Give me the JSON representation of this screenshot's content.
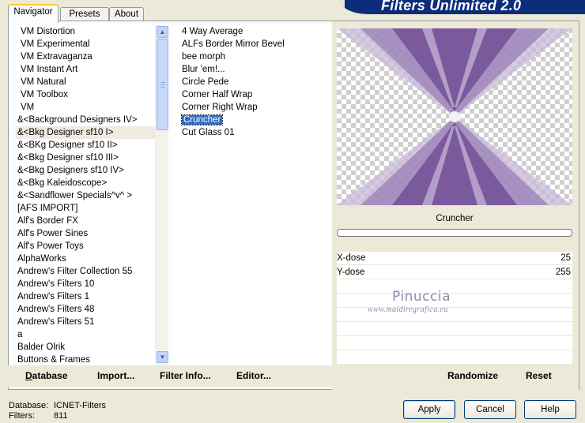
{
  "header": {
    "title": "Filters Unlimited 2.0"
  },
  "tabs": [
    {
      "label": "Navigator",
      "active": true
    },
    {
      "label": "Presets",
      "active": false
    },
    {
      "label": "About",
      "active": false
    }
  ],
  "categories": [
    "VM Distortion",
    "VM Experimental",
    "VM Extravaganza",
    "VM Instant Art",
    "VM Natural",
    "VM Toolbox",
    "VM",
    "&<Background Designers IV>",
    "&<Bkg Designer sf10 I>",
    "&<BKg Designer sf10 II>",
    "&<Bkg Designer sf10 III>",
    "&<Bkg Designers sf10 IV>",
    "&<Bkg Kaleidoscope>",
    "&<Sandflower Specials^v^ >",
    "[AFS IMPORT]",
    "Alf's Border FX",
    "Alf's Power Sines",
    "Alf's Power Toys",
    "AlphaWorks",
    "Andrew's Filter Collection 55",
    "Andrew's Filters 10",
    "Andrew's Filters 1",
    "Andrew's Filters 48",
    "Andrew's Filters 51",
    "a",
    "Balder Olrik",
    "Buttons & Frames"
  ],
  "highlighted_category": "&<Bkg Designer sf10 I>",
  "filters": [
    "4 Way Average",
    "ALFs Border Mirror Bevel",
    "bee morph",
    "Blur 'em!...",
    "Circle Pede",
    "Corner Half Wrap",
    "Corner Right Wrap",
    "Cruncher",
    "Cut Glass 01"
  ],
  "selected_filter": "Cruncher",
  "list_buttons": {
    "database": "Database",
    "import": "Import...",
    "filter_info": "Filter Info...",
    "editor": "Editor..."
  },
  "preview": {
    "filter_name": "Cruncher",
    "progress": 0
  },
  "parameters": [
    {
      "label": "X-dose",
      "value": "25"
    },
    {
      "label": "Y-dose",
      "value": "255"
    }
  ],
  "watermark": {
    "name": "Pinuccia",
    "url": "www.maidiregrafica.eu"
  },
  "param_buttons": {
    "randomize": "Randomize",
    "reset": "Reset"
  },
  "status": {
    "database_label": "Database:",
    "database_value": "ICNET-Filters",
    "filters_label": "Filters:",
    "filters_value": "811"
  },
  "dialog_buttons": {
    "apply": "Apply",
    "cancel": "Cancel",
    "help": "Help"
  },
  "colors": {
    "accent": "#316ac5",
    "banner": "#0b2d7a",
    "preview_purple": "#7a5a9c",
    "dialog_bg": "#ece9d8"
  }
}
